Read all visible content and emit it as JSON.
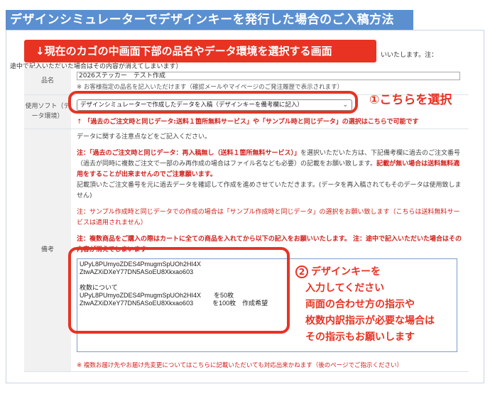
{
  "header": {
    "title": "デザインシミュレーターでデザインキーを発行した場合のご入稿方法"
  },
  "banner": {
    "text": "↓現在のカゴの中画面下部の品名やデータ環境を選択する画面"
  },
  "notice": {
    "tail": "いいたします。注：",
    "line2": "途中で記入いただいた場合はその内容が消えてしまいます）"
  },
  "form": {
    "name_row": {
      "label": "品名",
      "value": "2026ステッカー　テスト作成",
      "help": "※ お客様指定の品名を記入いただけます（確認メールやマイページのご発注履歴で表示されます）"
    },
    "software_row": {
      "label": "使用ソフト（データ環境）",
      "selected": "デザインシミュレーターで作成したデータを入稿（デザインキーを備考欄に記入）",
      "help_prefix": "↑ ",
      "help": "「過去のご注文時と同じデータ:送料１箇所無料サービス」や「サンプル時と同じデータ」の選択はこちらで可能です"
    },
    "notes_row": {
      "label": "備考",
      "intro": "データに関する注意点などをご記入ください。",
      "para1_red": "注：「過去のご注文時と同じデータ：再入稿無し（送料１箇所無料サービス）」",
      "para1_rest": "を選択いただいた方は、下記備考欄に過去のご注文番号（過去が同時に複数ご注文で一部のみ再作成の場合はファイル名なども必要）の記載をお願い致します。",
      "para1_red2": "記載が無い場合は送料無料適用をすることが出来ませんのでご注意願います。",
      "para1_tail": "記載頂いたご注文番号を元に過去データを確認して作成を進めさせていただきます。(データを再入稿されてもそのデータは使用致しません)",
      "para2": "注：サンプル作成時と同じデータでの作成の場合は「サンプル作成時と同じデータ」の選択をお願い致します（こちらは送料無料サービスは適用されません）",
      "para3": "注：複数商品をご購入の際はカートに全ての商品を入れてから以下の記入をお願いいたします。 注：途中で記入いただいた場合はその内容が消えてしまいます",
      "textarea_value": "UPyL8PUmyoZDES4PmugmSpUOh2HI4X\nZtwAZXiDXeY77DN5ASoEU8Xkxao603\n\n枚数について\nUPyL8PUmyoZDES4PmugmSpUOh2HI4X　　を50枚\nZtwAZXiDXeY77DN5ASoEU8Xkxao603　　　を100枚　作成希望",
      "footer": "※ 複数お届け先やお届け先変更についてはこちらに記載いただいても対応出来かねます（後のページでご指示ください）"
    }
  },
  "callouts": {
    "one": "①こちらを選択",
    "two_num": "2",
    "two_lines": [
      "デザインキーを",
      "入力してください",
      "両面の合わせ方の指示や",
      "枚数内訳指示が必要な場合は",
      "その指示もお願いします"
    ]
  },
  "colors": {
    "header_blue": "#5b8fd0",
    "accent_red": "#e83323",
    "text_red": "#d0201a"
  }
}
